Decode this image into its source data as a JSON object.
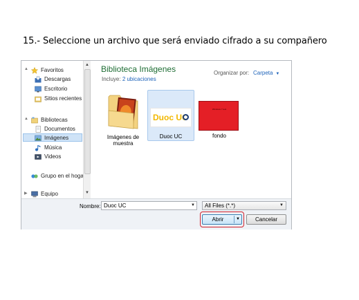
{
  "instruction": "15.- Seleccione un archivo que será enviado cifrado a su compañero",
  "nav": {
    "items": [
      {
        "label": "Favoritos",
        "icon": "star-icon"
      },
      {
        "label": "Descargas",
        "icon": "downloads-icon"
      },
      {
        "label": "Escritorio",
        "icon": "desktop-icon"
      },
      {
        "label": "Sitios recientes",
        "icon": "recent-places-icon"
      },
      {
        "label": "Bibliotecas",
        "icon": "libraries-icon"
      },
      {
        "label": "Documentos",
        "icon": "documents-icon"
      },
      {
        "label": "Imágenes",
        "icon": "pictures-icon",
        "selected": true
      },
      {
        "label": "Música",
        "icon": "music-icon"
      },
      {
        "label": "Videos",
        "icon": "videos-icon"
      },
      {
        "label": "Grupo en el hogar",
        "icon": "homegroup-icon"
      },
      {
        "label": "Equipo",
        "icon": "computer-icon"
      }
    ]
  },
  "library": {
    "title": "Biblioteca Imágenes",
    "includes_label": "Incluye:",
    "includes_link": "2 ubicaciones",
    "arrange_label": "Organizar por:",
    "arrange_value": "Carpeta"
  },
  "files": [
    {
      "label": "Imágenes de muestra",
      "line1": "Imágenes de",
      "line2": "muestra",
      "type": "folder"
    },
    {
      "label": "Duoc UC",
      "type": "image",
      "thumb_text": "Duoc UC",
      "selected": true
    },
    {
      "label": "fondo",
      "type": "image",
      "thumb_text": "Windows 7 test"
    }
  ],
  "footer": {
    "name_label": "Nombre:",
    "name_value": "Duoc UC",
    "filter_value": "All Files (*.*)",
    "open_label": "Abrir",
    "cancel_label": "Cancelar"
  },
  "colors": {
    "library_title": "#1e6d34",
    "link": "#1c62b9",
    "selection": "#cfe3f7",
    "highlight": "#d0202c",
    "fondo_red": "#e41f26",
    "duoc_gold": "#f2b800"
  }
}
